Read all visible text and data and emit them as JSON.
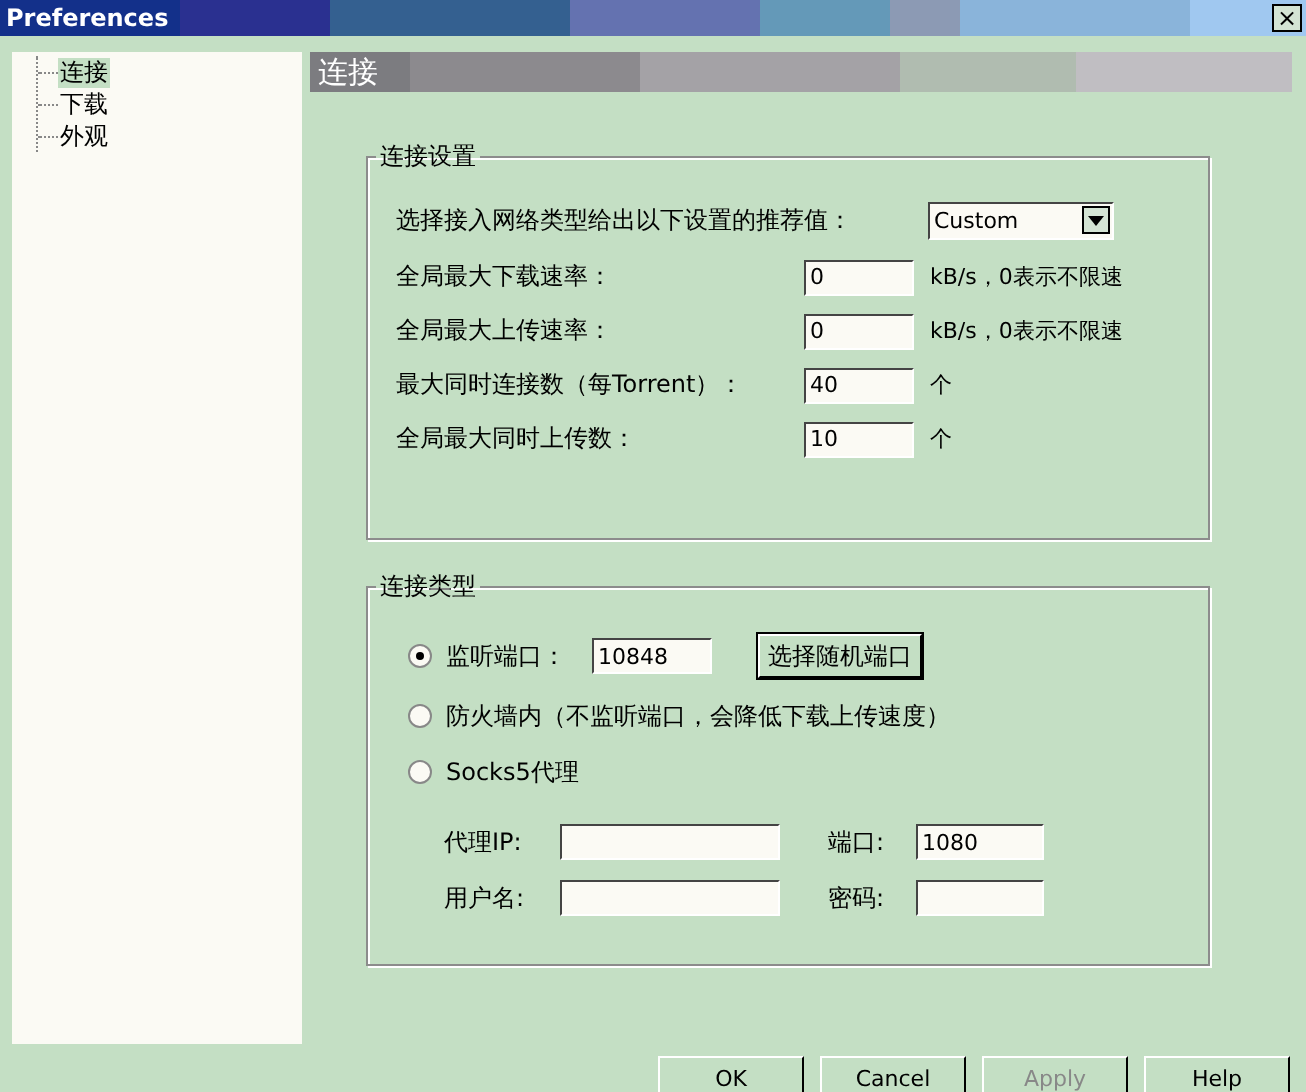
{
  "window": {
    "title": "Preferences",
    "close": "×"
  },
  "sidebar": {
    "items": [
      {
        "label": "连接",
        "selected": true
      },
      {
        "label": "下载",
        "selected": false
      },
      {
        "label": "外观",
        "selected": false
      }
    ]
  },
  "header": {
    "title": "连接"
  },
  "connection_settings": {
    "title": "连接设置",
    "rows": [
      {
        "kind": "select",
        "label": "选择接入网络类型给出以下设置的推荐值：",
        "value": "Custom"
      },
      {
        "kind": "input",
        "label": "全局最大下载速率：",
        "value": "0",
        "unit": "kB/s，0表示不限速"
      },
      {
        "kind": "input",
        "label": "全局最大上传速率：",
        "value": "0",
        "unit": "kB/s，0表示不限速"
      },
      {
        "kind": "input",
        "label": "最大同时连接数（每Torrent）：",
        "value": "40",
        "unit": "个"
      },
      {
        "kind": "input",
        "label": "全局最大同时上传数：",
        "value": "10",
        "unit": "个"
      }
    ]
  },
  "connection_type": {
    "title": "连接类型",
    "options": [
      {
        "label": "监听端口：",
        "selected": true,
        "value": "10848",
        "button": "选择随机端口"
      },
      {
        "label": "防火墙内（不监听端口，会降低下载上传速度）",
        "selected": false
      },
      {
        "label": "Socks5代理",
        "selected": false
      }
    ],
    "proxy_fields": [
      {
        "label": "代理IP:"
      },
      {
        "label": "端口:",
        "value": "1080"
      },
      {
        "label": "用户名:"
      },
      {
        "label": "密码:"
      }
    ]
  },
  "buttons": [
    {
      "label": "OK",
      "disabled": false
    },
    {
      "label": "Cancel",
      "disabled": false
    },
    {
      "label": "Apply",
      "disabled": true
    },
    {
      "label": "Help",
      "disabled": false
    }
  ]
}
